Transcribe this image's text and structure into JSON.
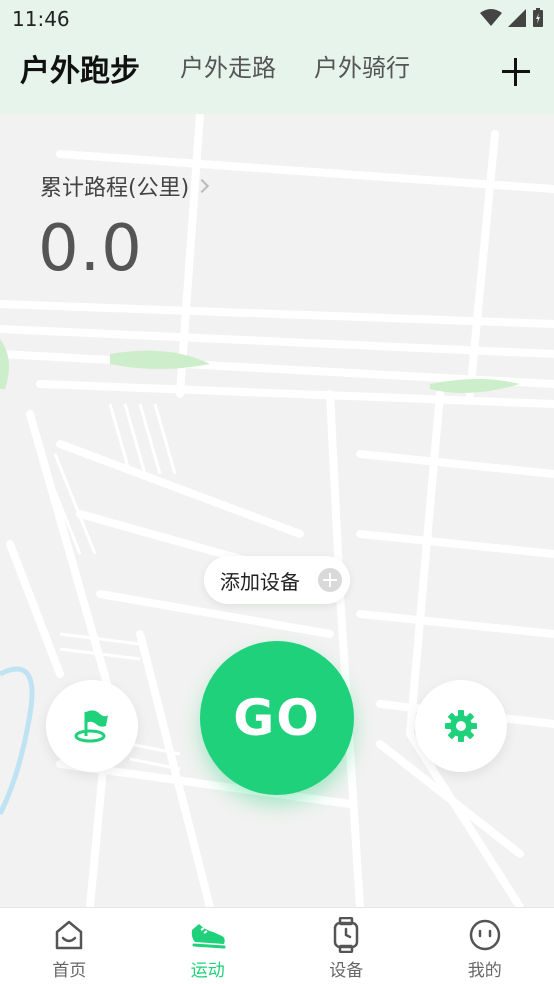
{
  "status": {
    "time": "11:46"
  },
  "tabs": [
    {
      "label": "户外跑步",
      "active": true
    },
    {
      "label": "户外走路",
      "active": false
    },
    {
      "label": "户外骑行",
      "active": false
    }
  ],
  "stats": {
    "label": "累计路程(公里)",
    "value": "0.0"
  },
  "actions": {
    "add_device": "添加设备",
    "go": "GO"
  },
  "nav": [
    {
      "label": "首页",
      "icon": "home-face-icon",
      "active": false
    },
    {
      "label": "运动",
      "icon": "sneaker-icon",
      "active": true
    },
    {
      "label": "设备",
      "icon": "watch-icon",
      "active": false
    },
    {
      "label": "我的",
      "icon": "profile-face-icon",
      "active": false
    }
  ],
  "colors": {
    "accent": "#1fd17a",
    "header_bg": "#e6f4ec"
  }
}
